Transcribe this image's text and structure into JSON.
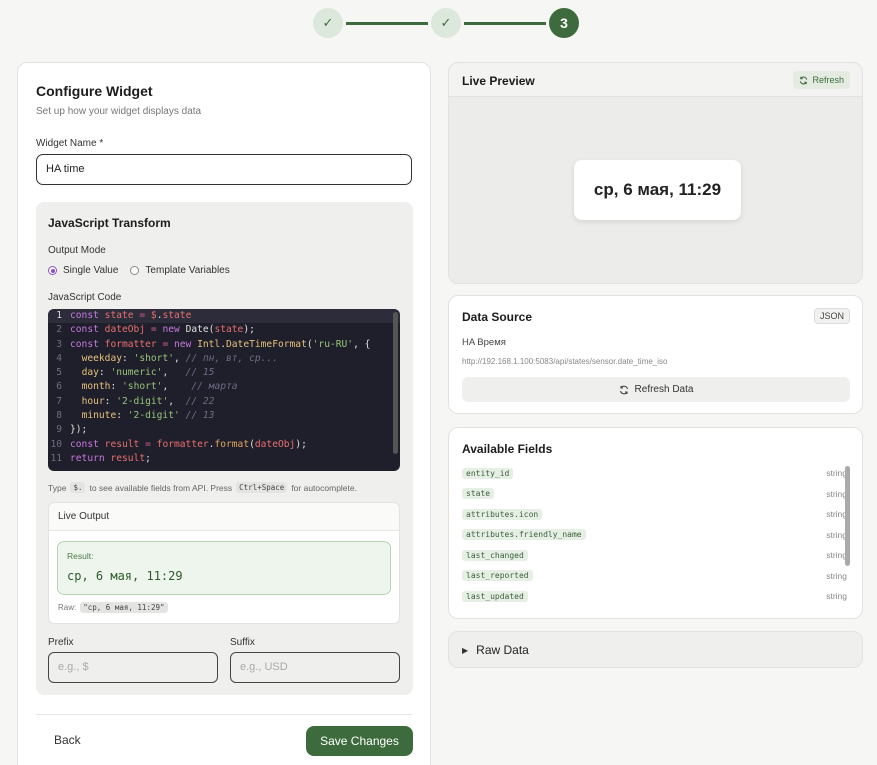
{
  "stepper": {
    "step1": "✓",
    "step2": "✓",
    "step3": "3"
  },
  "config": {
    "title": "Configure Widget",
    "subtitle": "Set up how your widget displays data",
    "name_label": "Widget Name *",
    "name_value": "HA time"
  },
  "js": {
    "title": "JavaScript Transform",
    "output_mode_label": "Output Mode",
    "mode_single": "Single Value",
    "mode_template": "Template Variables",
    "code_label": "JavaScript Code",
    "hint_pre": "Type",
    "hint_key1": "$.",
    "hint_mid": "to see available fields from API. Press",
    "hint_key2": "Ctrl+Space",
    "hint_post": "for autocomplete."
  },
  "live_output": {
    "title": "Live Output",
    "result_label": "Result:",
    "result_value": "ср, 6 мая, 11:29",
    "raw_label": "Raw:",
    "raw_value": "\"ср, 6 мая, 11:29\""
  },
  "prefix": {
    "label": "Prefix",
    "placeholder": "e.g., $"
  },
  "suffix": {
    "label": "Suffix",
    "placeholder": "e.g., USD"
  },
  "actions": {
    "back": "Back",
    "save": "Save Changes"
  },
  "preview": {
    "title": "Live Preview",
    "refresh": "Refresh",
    "widget_value": "ср, 6 мая, 11:29"
  },
  "data_source": {
    "title": "Data Source",
    "badge": "JSON",
    "name": "HA Время",
    "url": "http://192.168.1.100:5083/api/states/sensor.date_time_iso",
    "refresh": "Refresh Data"
  },
  "fields": {
    "title": "Available Fields",
    "items": [
      {
        "name": "entity_id",
        "type": "string"
      },
      {
        "name": "state",
        "type": "string"
      },
      {
        "name": "attributes.icon",
        "type": "string"
      },
      {
        "name": "attributes.friendly_name",
        "type": "string"
      },
      {
        "name": "last_changed",
        "type": "string"
      },
      {
        "name": "last_reported",
        "type": "string"
      },
      {
        "name": "last_updated",
        "type": "string"
      }
    ]
  },
  "raw_data": {
    "title": "Raw Data"
  },
  "colors": {
    "accent": "#3e6b3d",
    "accent_light": "#dde8dc",
    "code_bg": "#1f1f2b"
  }
}
